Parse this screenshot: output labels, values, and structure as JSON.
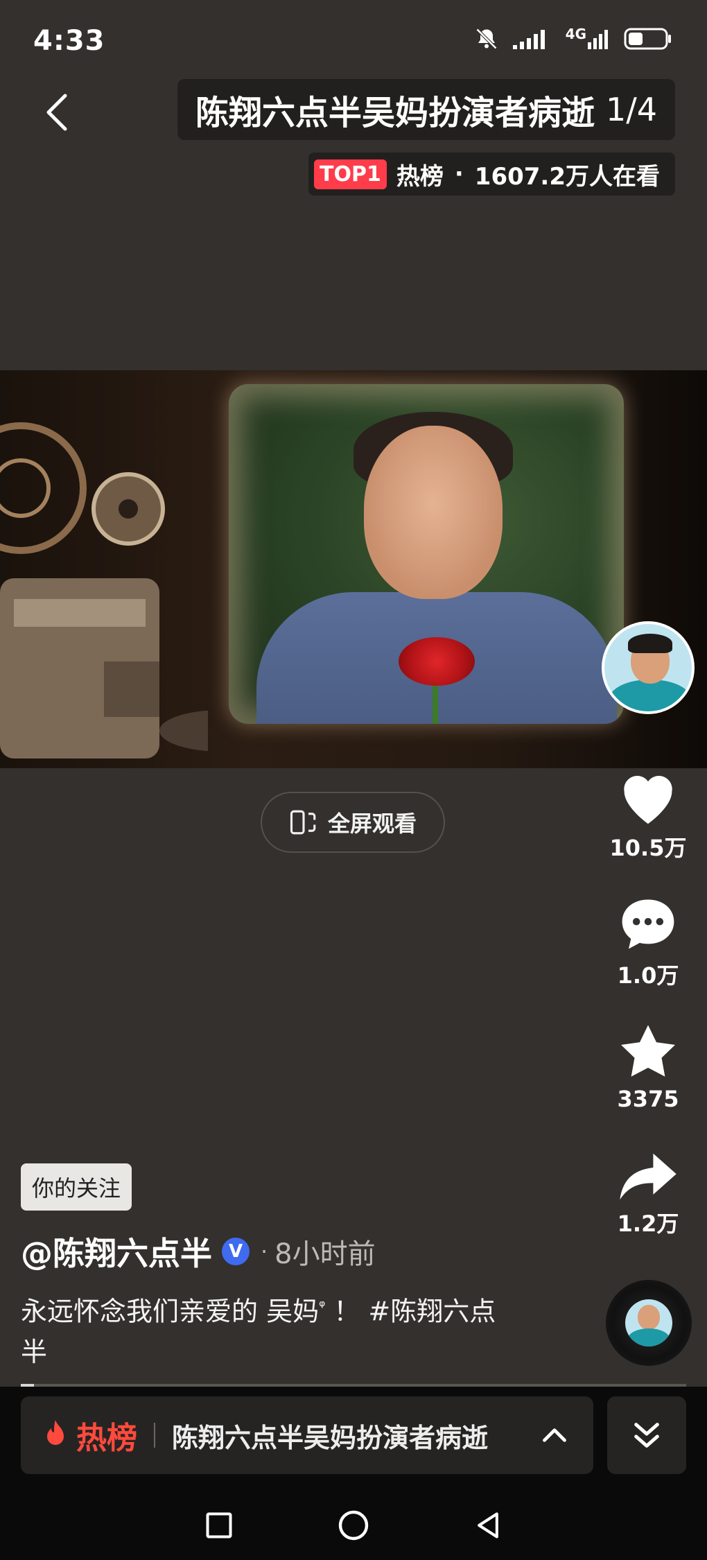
{
  "status_bar": {
    "time": "4:33",
    "network": "4G",
    "icons": [
      "bell-muted-icon",
      "signal-icon",
      "signal-4g-icon",
      "battery-icon"
    ]
  },
  "header": {
    "back_icon": "chevron-left-icon",
    "topic_title": "陈翔六点半吴妈扮演者病逝",
    "page_indicator": "1/4",
    "badge": "TOP1",
    "hot_label": "热榜",
    "separator": "·",
    "viewers": "1607.2万人在看"
  },
  "fullscreen_button": {
    "label": "全屏观看",
    "icon": "rotate-screen-icon"
  },
  "actions": {
    "like_count": "10.5万",
    "comment_count": "1.0万",
    "favorite_count": "3375",
    "share_count": "1.2万"
  },
  "post": {
    "follow_tag": "你的关注",
    "author": "@陈翔六点半",
    "verified": "V",
    "separator": "·",
    "time": "8小时前",
    "caption_text": "永远怀念我们亲爱的 吴妈",
    "caption_search_mark": "ᵠ",
    "caption_punct": " ！ ",
    "hashtag": "#陈翔六点半"
  },
  "progress": {
    "fraction": 0.02
  },
  "hot_bar": {
    "label": "热榜",
    "topic": "陈翔六点半吴妈扮演者病逝",
    "icon": "fire-icon"
  },
  "nav": {
    "icons": [
      "recent-apps-icon",
      "home-icon",
      "back-icon"
    ]
  },
  "colors": {
    "background": "#33302d",
    "accent_red": "#fe3c4a",
    "verified_blue": "#3f6bf0"
  }
}
